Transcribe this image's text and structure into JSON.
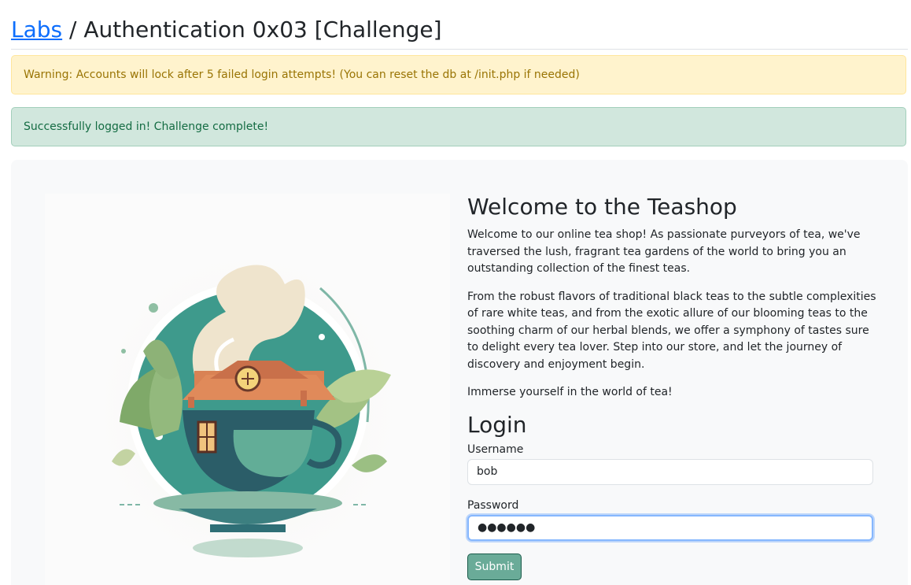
{
  "breadcrumb": {
    "link_label": "Labs",
    "separator": " / ",
    "page_title": "Authentication 0x03 [Challenge]"
  },
  "alerts": {
    "warning": "Warning: Accounts will lock after 5 failed login attempts! (You can reset the db at /init.php if needed)",
    "success": "Successfully logged in! Challenge complete!"
  },
  "shop": {
    "heading": "Welcome to the Teashop",
    "paragraphs": [
      "Welcome to our online tea shop! As passionate purveyors of tea, we've traversed the lush, fragrant tea gardens of the world to bring you an outstanding collection of the finest teas.",
      "From the robust flavors of traditional black teas to the subtle complexities of rare white teas, and from the exotic allure of our blooming teas to the soothing charm of our herbal blends, we offer a symphony of tastes sure to delight every tea lover. Step into our store, and let the journey of discovery and enjoyment begin.",
      "Immerse yourself in the world of tea!"
    ],
    "image_icon": "teacup-house-illustration"
  },
  "login": {
    "heading": "Login",
    "username_label": "Username",
    "username_value": "bob",
    "password_label": "Password",
    "password_value": "●●●●●●",
    "submit_label": "Submit"
  },
  "colors": {
    "link": "#0d6efd",
    "warning_bg": "#fff3cd",
    "warning_text": "#997404",
    "success_bg": "#d1e7dd",
    "success_text": "#146c43",
    "submit_bg": "#6aab98",
    "focus_ring": "#86b7fe"
  }
}
